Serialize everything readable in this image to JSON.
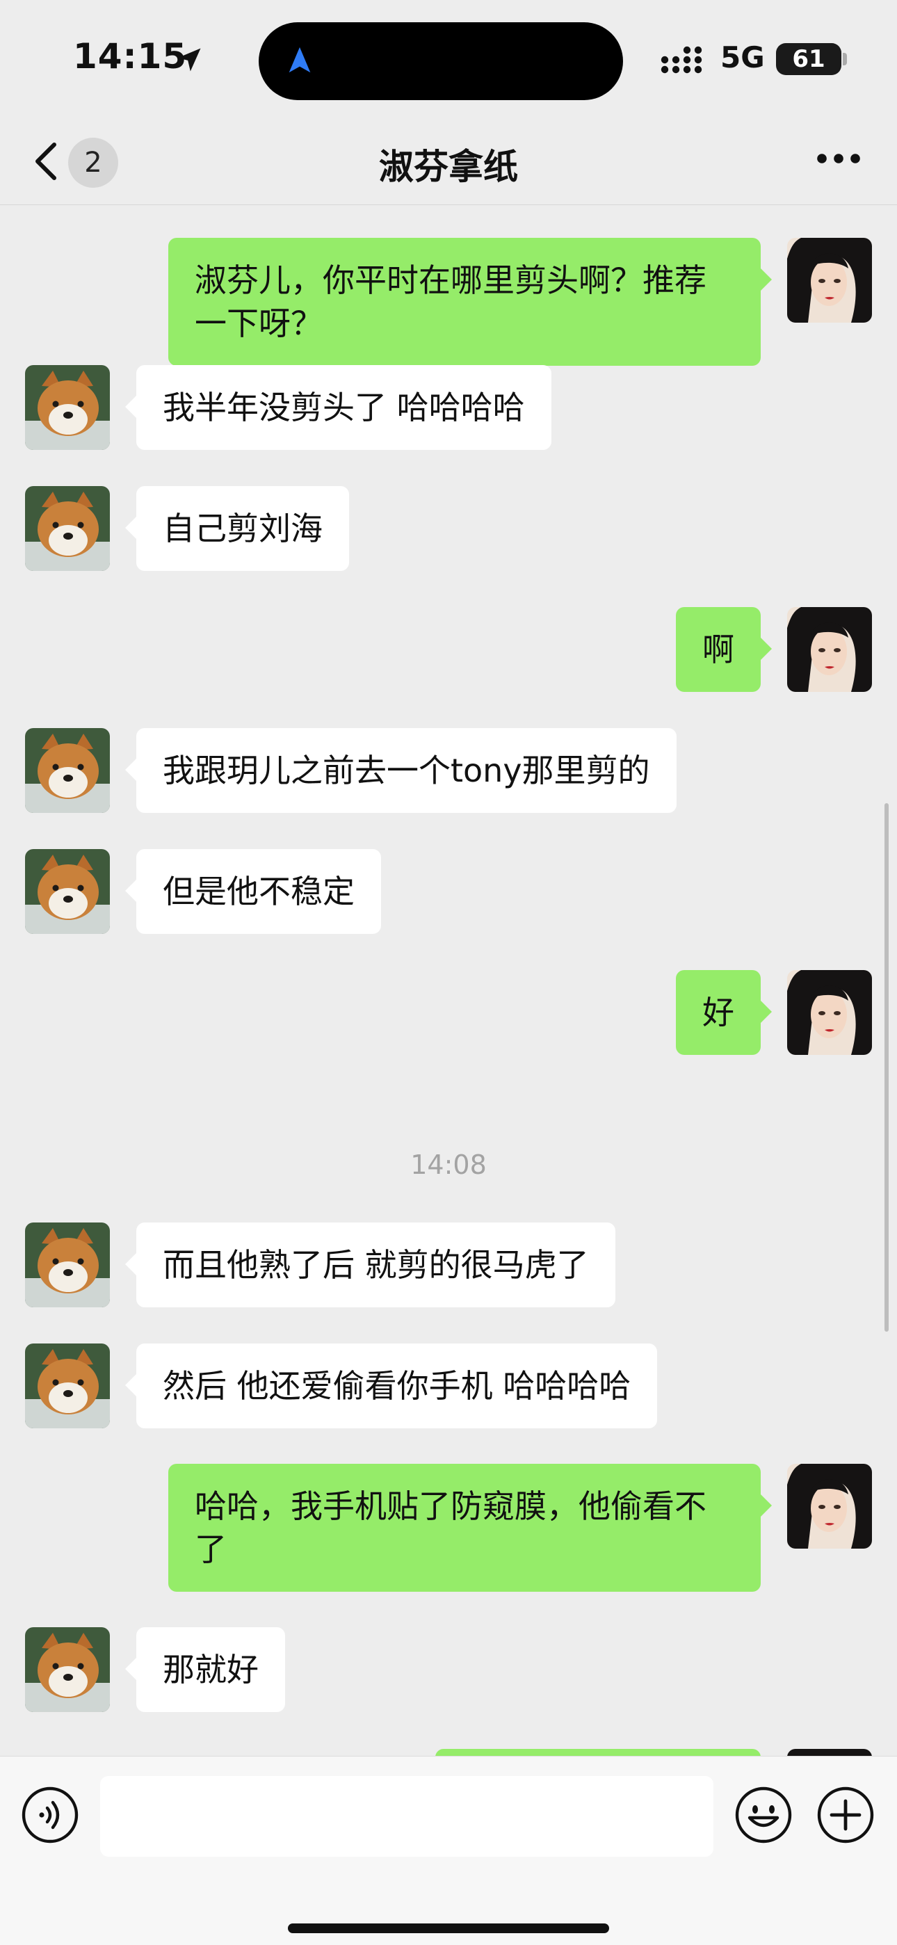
{
  "status_bar": {
    "time": "14:15",
    "network": "5G",
    "battery": "61",
    "battery_level_pct": 61
  },
  "nav": {
    "unread_count": "2",
    "title": "淑芬拿纸"
  },
  "messages": [
    {
      "side": "out",
      "text": "淑芬儿，你平时在哪里剪头啊？推荐一下呀？",
      "avatar": "girl-avatar"
    },
    {
      "side": "in",
      "text": "我半年没剪头了 哈哈哈哈",
      "avatar": "shiba-avatar"
    },
    {
      "side": "in",
      "text": "自己剪刘海",
      "avatar": "shiba-avatar"
    },
    {
      "side": "out",
      "text": "啊",
      "avatar": "girl-avatar"
    },
    {
      "side": "in",
      "text": "我跟玥儿之前去一个tony那里剪的",
      "avatar": "shiba-avatar"
    },
    {
      "side": "in",
      "text": "但是他不稳定",
      "avatar": "shiba-avatar"
    },
    {
      "side": "out",
      "text": "好",
      "avatar": "girl-avatar"
    },
    {
      "type": "timestamp",
      "text": "14:08"
    },
    {
      "side": "in",
      "text": "而且他熟了后 就剪的很马虎了",
      "avatar": "shiba-avatar"
    },
    {
      "side": "in",
      "text": "然后 他还爱偷看你手机 哈哈哈哈",
      "avatar": "shiba-avatar"
    },
    {
      "side": "out",
      "text": "哈哈，我手机贴了防窥膜，他偷看不了",
      "avatar": "girl-avatar"
    },
    {
      "side": "in",
      "text": "那就好",
      "avatar": "shiba-avatar"
    }
  ],
  "input": {
    "value": "",
    "placeholder": ""
  },
  "colors": {
    "background": "#ededed",
    "outgoing_bubble": "#95ec69",
    "incoming_bubble": "#ffffff",
    "timestamp": "#a3a3a3"
  }
}
